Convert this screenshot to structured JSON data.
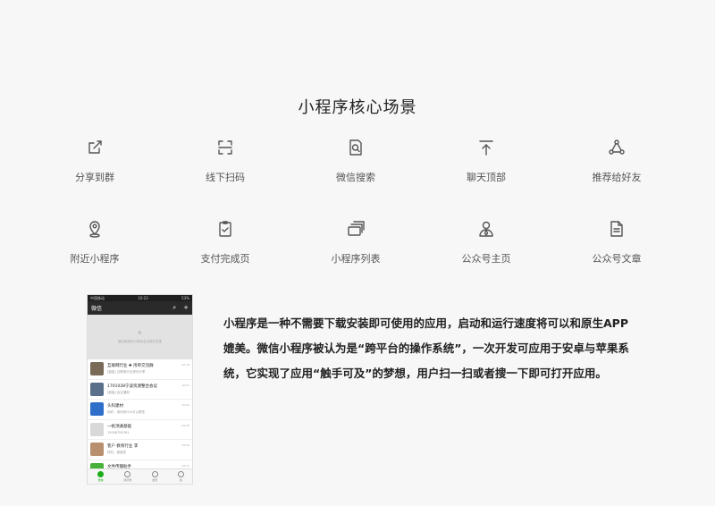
{
  "title": "小程序核心场景",
  "scenes": [
    {
      "label": "分享到群",
      "icon": "share-icon"
    },
    {
      "label": "线下扫码",
      "icon": "scan-icon"
    },
    {
      "label": "微信搜索",
      "icon": "search-doc-icon"
    },
    {
      "label": "聊天顶部",
      "icon": "pull-top-icon"
    },
    {
      "label": "推荐给好友",
      "icon": "recommend-icon"
    },
    {
      "label": "附近小程序",
      "icon": "location-icon"
    },
    {
      "label": "支付完成页",
      "icon": "payment-done-icon"
    },
    {
      "label": "小程序列表",
      "icon": "list-stack-icon"
    },
    {
      "label": "公众号主页",
      "icon": "account-icon"
    },
    {
      "label": "公众号文章",
      "icon": "article-icon"
    }
  ],
  "phone": {
    "status_left": "中国移动",
    "status_time": "10:23",
    "status_right": "53%",
    "nav_title": "微信",
    "pulldown_text": "最近使用的小程序会出现在这里",
    "chats": [
      {
        "name": "互联网行业 ✚ 甩单交流群",
        "msg": "[链接] 互联网行业资讯分享",
        "time": "10:19",
        "color": "#7a6a58"
      },
      {
        "name": "1701028宁波资源整合会议",
        "msg": "[链接] 会议通知",
        "time": "10:01",
        "color": "#5a6f8a"
      },
      {
        "name": "头科建材",
        "msg": "你好，请问有什么可以帮您",
        "time": "10:00",
        "color": "#2f6fc9"
      },
      {
        "name": "一帆顶通基础",
        "msg": "15008783761",
        "time": "09:56",
        "color": "#d8d8d8"
      },
      {
        "name": "客户 教育行业 李",
        "msg": "好的，谢谢您",
        "time": "09:50",
        "color": "#b89070"
      },
      {
        "name": "文件传输助手",
        "msg": "[视频]",
        "time": "09:41",
        "color": "#46b038"
      }
    ],
    "tabs": [
      "微信",
      "通讯录",
      "发现",
      "我"
    ]
  },
  "description": "小程序是一种不需要下载安装即可使用的应用，启动和运行速度将可以和原生APP媲美。微信小程序被认为是“跨平台的操作系统”，一次开发可应用于安卓与苹果系统，它实现了应用“触手可及”的梦想，用户扫一扫或者搜一下即可打开应用。"
}
